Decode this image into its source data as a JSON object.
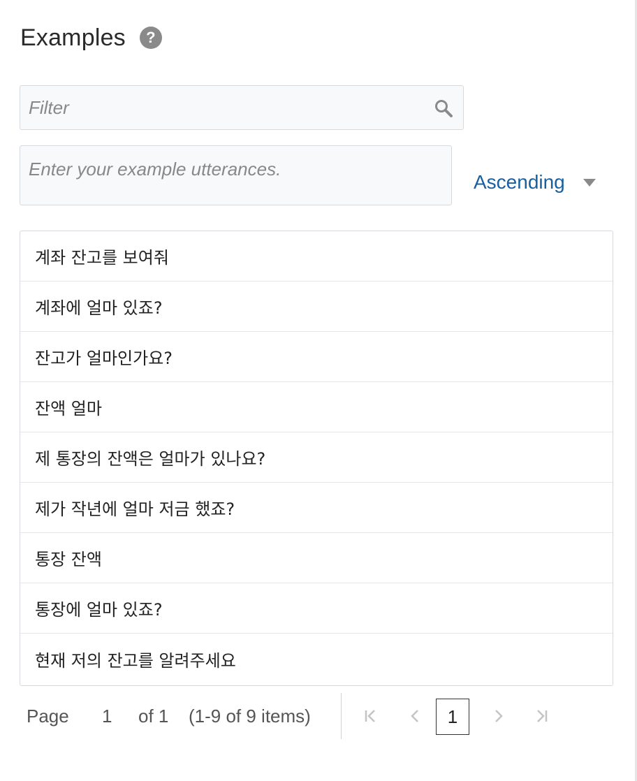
{
  "header": {
    "title": "Examples",
    "help_glyph": "?"
  },
  "filter": {
    "placeholder": "Filter",
    "value": ""
  },
  "utterance_input": {
    "placeholder": "Enter your example utterances.",
    "value": ""
  },
  "sort": {
    "selected": "Ascending"
  },
  "examples": [
    "계좌 잔고를 보여줘",
    "계좌에 얼마 있죠?",
    "잔고가 얼마인가요?",
    "잔액 얼마",
    "제 통장의 잔액은 얼마가 있나요?",
    "제가 작년에 얼마 저금 했죠?",
    "통장 잔액",
    "통장에 얼마 있죠?",
    "현재 저의 잔고를 알려주세요"
  ],
  "pager": {
    "page_label": "Page",
    "page_value": "1",
    "of_label": "of 1",
    "items_summary": "(1-9 of 9 items)",
    "current_page": "1"
  },
  "icons": {
    "help": "help-icon",
    "search": "search-icon",
    "caret": "caret-down-icon",
    "first": "first-page-icon",
    "prev": "prev-page-icon",
    "next": "next-page-icon",
    "last": "last-page-icon"
  },
  "colors": {
    "accent": "#1a5fa0",
    "icon_gray": "#8a8a8a",
    "border": "#d6dae0",
    "input_bg": "#f8f9fb"
  }
}
